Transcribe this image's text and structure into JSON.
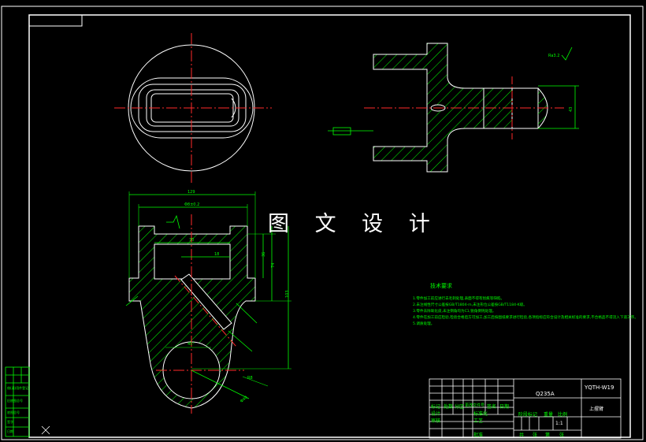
{
  "watermark": "图 文 设 计",
  "title_block": {
    "material": "Q235A",
    "drawing_number": "YQTH-W19",
    "part_name": "上摆臂",
    "scale": "1:1",
    "labels": {
      "mark": "标记",
      "count": "处数",
      "zone": "分区",
      "change_doc": "更改文件号",
      "sign": "签名",
      "date": "日期",
      "design": "设计",
      "standardize": "标准化",
      "stage_mark": "阶段标记",
      "weight": "重量",
      "ratio": "比例",
      "review": "审核",
      "process": "工艺",
      "approve": "批准",
      "sheet_total": "共",
      "sheet_num": "张",
      "page": "第",
      "page_unit": "张"
    }
  },
  "tech_notes": {
    "title": "技术要求",
    "items": [
      "1.零件加工前应进行去毛刺处理,表面不得有划痕等缺陷。",
      "2.未注线性尺寸公差按GB/T1804-m,未注形位公差按GB/T1184-K级。",
      "3.零件去除氧化皮,未注倒角均为C1,锐角倒钝处理。",
      "4.零件在加工前应检验,检验合格后方可加工,加工后按图纸要求进行检验,各项指标应符合设计及相关标准的要求,不合格品不得流入下道工序。",
      "5.调质处理。"
    ]
  },
  "dimensions": {
    "overall_width": "129",
    "inner_width": "Φ8±0.2",
    "inner_span": "70",
    "offset": "18",
    "right_1": "36",
    "right_2": "74",
    "right_3": "103",
    "right_view_dia": "43",
    "hole_angle": "45°",
    "radius": "R8",
    "lower_label": "Φ40",
    "roughness": "Ra3.2"
  },
  "left_margin_labels": [
    "借(通)用件登记",
    "旧底图总号",
    "底图总号",
    "签字",
    "日期"
  ]
}
